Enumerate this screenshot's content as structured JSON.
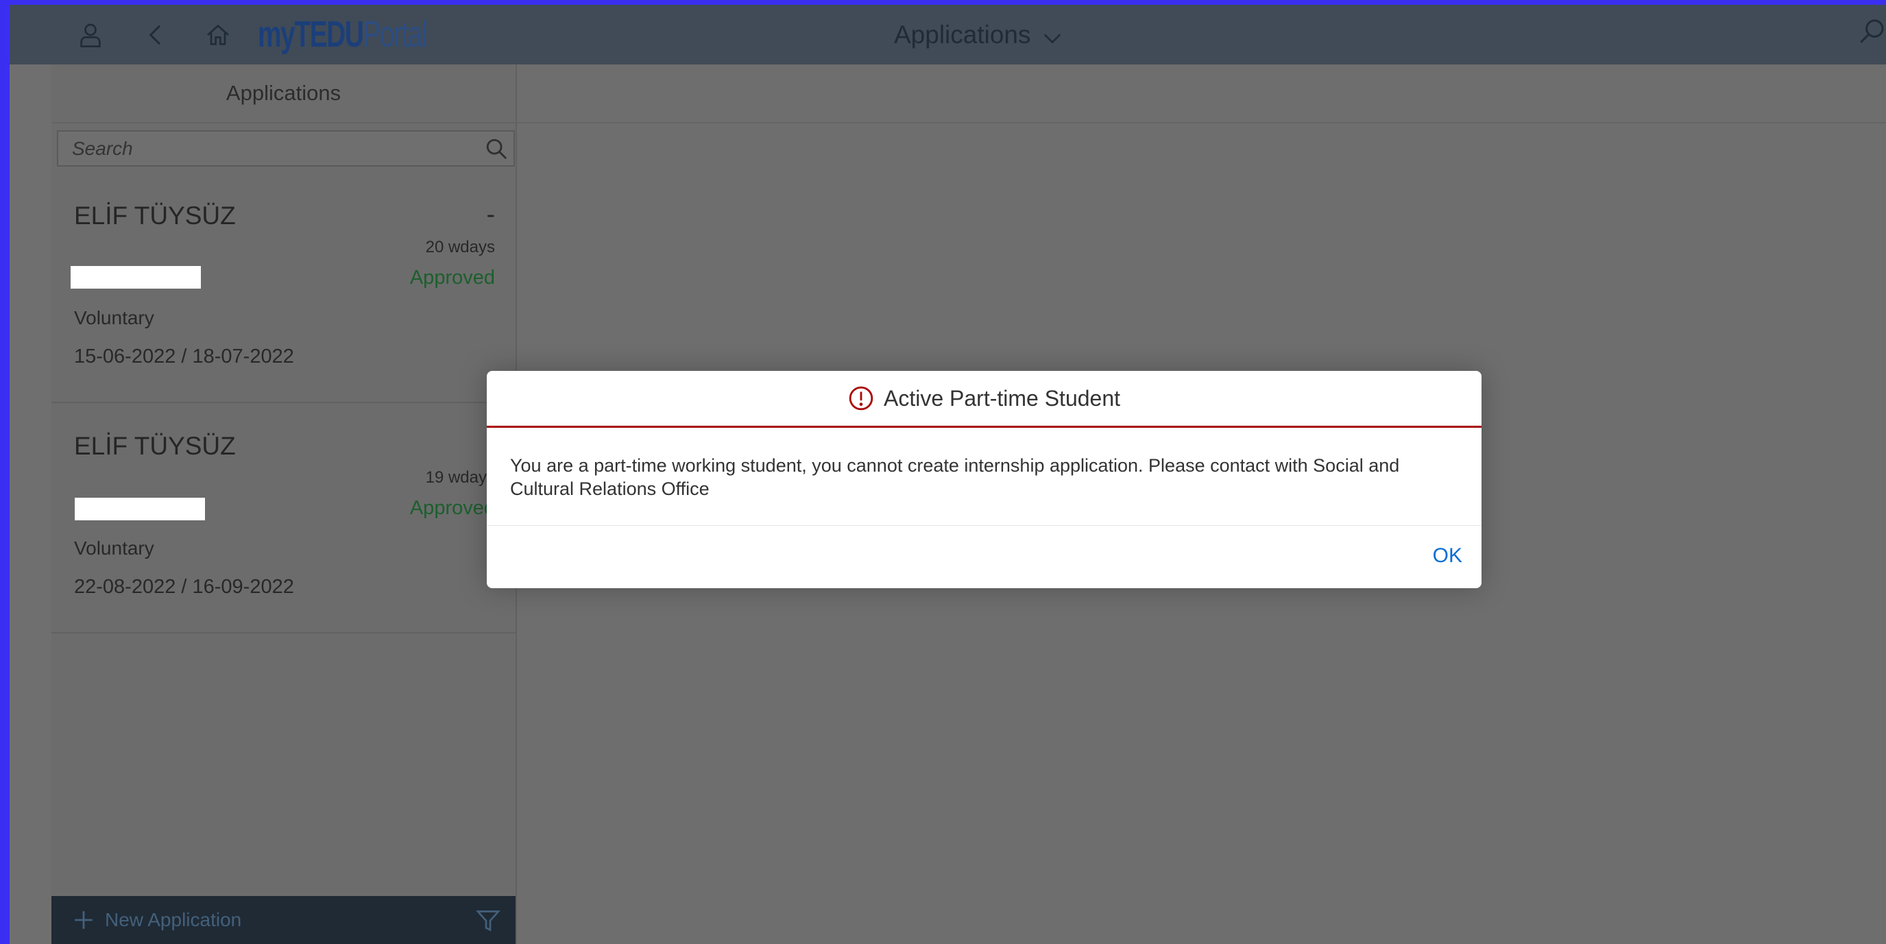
{
  "shell": {
    "logo_part1": "my",
    "logo_part2": "TEDU",
    "logo_part3": "Portal",
    "title": "Applications"
  },
  "master": {
    "title": "Applications",
    "search_placeholder": "Search",
    "items": [
      {
        "name": "ELİF TÜYSÜZ",
        "dash": "-",
        "wdays": "20 wdays",
        "status": "Approved",
        "type": "Voluntary",
        "dates": "15-06-2022 / 18-07-2022"
      },
      {
        "name": "ELİF TÜYSÜZ",
        "dash": "-",
        "wdays": "19 wdays",
        "status": "Approved",
        "type": "Voluntary",
        "dates": "22-08-2022 / 16-09-2022"
      }
    ],
    "footer": {
      "new_application": "New Application"
    }
  },
  "dialog": {
    "title": "Active Part-time Student",
    "message": "You are a part-time working student, you cannot create internship application. Please contact with Social and Cultural Relations Office",
    "ok_label": "OK"
  },
  "colors": {
    "shell": "#404b57",
    "overlay": "#6f6f6f",
    "error_red": "#aa0808",
    "link_blue": "#0a6ed1",
    "approved_green": "#1c5f2d"
  }
}
